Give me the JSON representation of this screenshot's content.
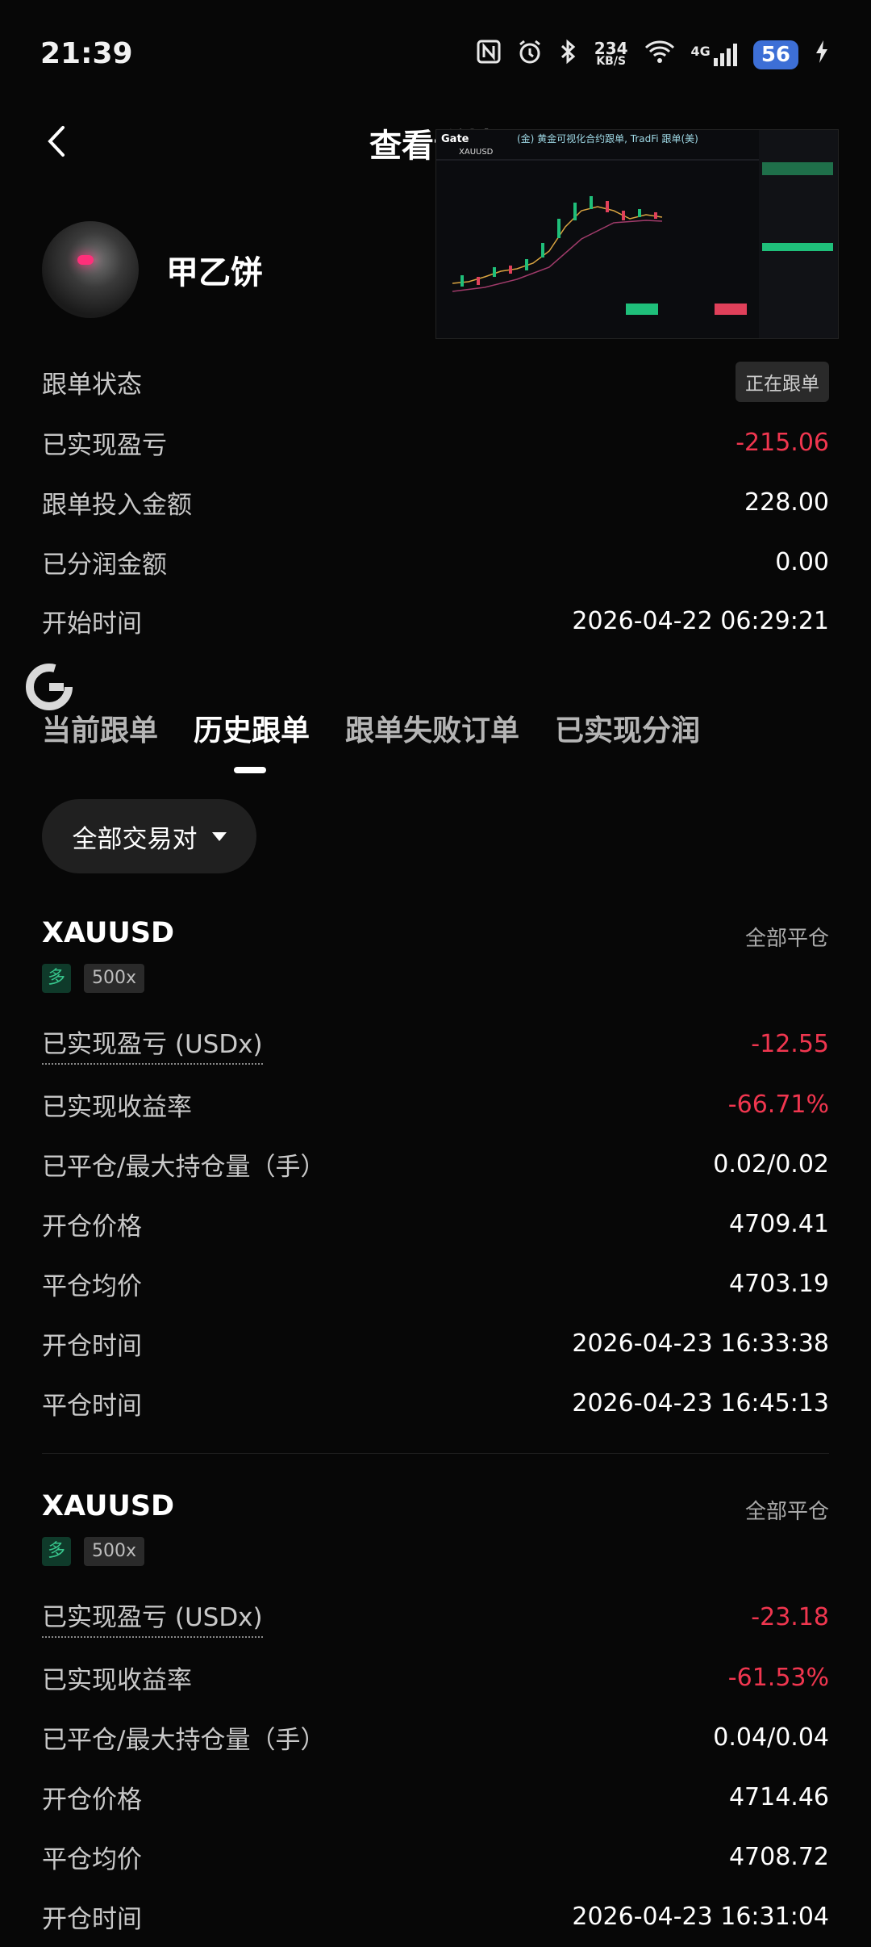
{
  "status_bar": {
    "time": "21:39",
    "net_speed": "234",
    "net_unit": "KB/S",
    "network": "4G",
    "battery": "56"
  },
  "header": {
    "title": "查看详情"
  },
  "profile": {
    "name": "甲乙饼"
  },
  "summary": {
    "status_label": "跟单状态",
    "status_value": "正在跟单",
    "pnl_label": "已实现盈亏",
    "pnl_value": "-215.06",
    "invest_label": "跟单投入金额",
    "invest_value": "228.00",
    "profit_share_label": "已分润金额",
    "profit_share_value": "0.00",
    "start_label": "开始时间",
    "start_value": "2026-04-22 06:29:21"
  },
  "tabs": [
    "当前跟单",
    "历史跟单",
    "跟单失败订单",
    "已实现分润"
  ],
  "filter": {
    "label": "全部交易对"
  },
  "orders": [
    {
      "symbol": "XAUUSD",
      "status": "全部平仓",
      "side": "多",
      "leverage": "500x",
      "pnl_label": "已实现盈亏 (USDx)",
      "pnl": "-12.55",
      "roi_label": "已实现收益率",
      "roi": "-66.71%",
      "qty_label": "已平仓/最大持仓量（手）",
      "qty": "0.02/0.02",
      "open_price_label": "开仓价格",
      "open_price": "4709.41",
      "close_price_label": "平仓均价",
      "close_price": "4703.19",
      "open_time_label": "开仓时间",
      "open_time": "2026-04-23 16:33:38",
      "close_time_label": "平仓时间",
      "close_time": "2026-04-23 16:45:13"
    },
    {
      "symbol": "XAUUSD",
      "status": "全部平仓",
      "side": "多",
      "leverage": "500x",
      "pnl_label": "已实现盈亏 (USDx)",
      "pnl": "-23.18",
      "roi_label": "已实现收益率",
      "roi": "-61.53%",
      "qty_label": "已平仓/最大持仓量（手）",
      "qty": "0.04/0.04",
      "open_price_label": "开仓价格",
      "open_price": "4714.46",
      "close_price_label": "平仓均价",
      "close_price": "4708.72",
      "open_time_label": "开仓时间",
      "open_time": "2026-04-23 16:31:04"
    }
  ],
  "pip": {
    "brand": "Gate",
    "symbol": "XAUUSD",
    "banner": "(金) 黄金可视化合约跟单, TradFi 跟单(美)"
  },
  "colors": {
    "background": "#070707",
    "loss": "#f0364f",
    "long": "#37c58c",
    "tab_active": "#ffffff"
  }
}
